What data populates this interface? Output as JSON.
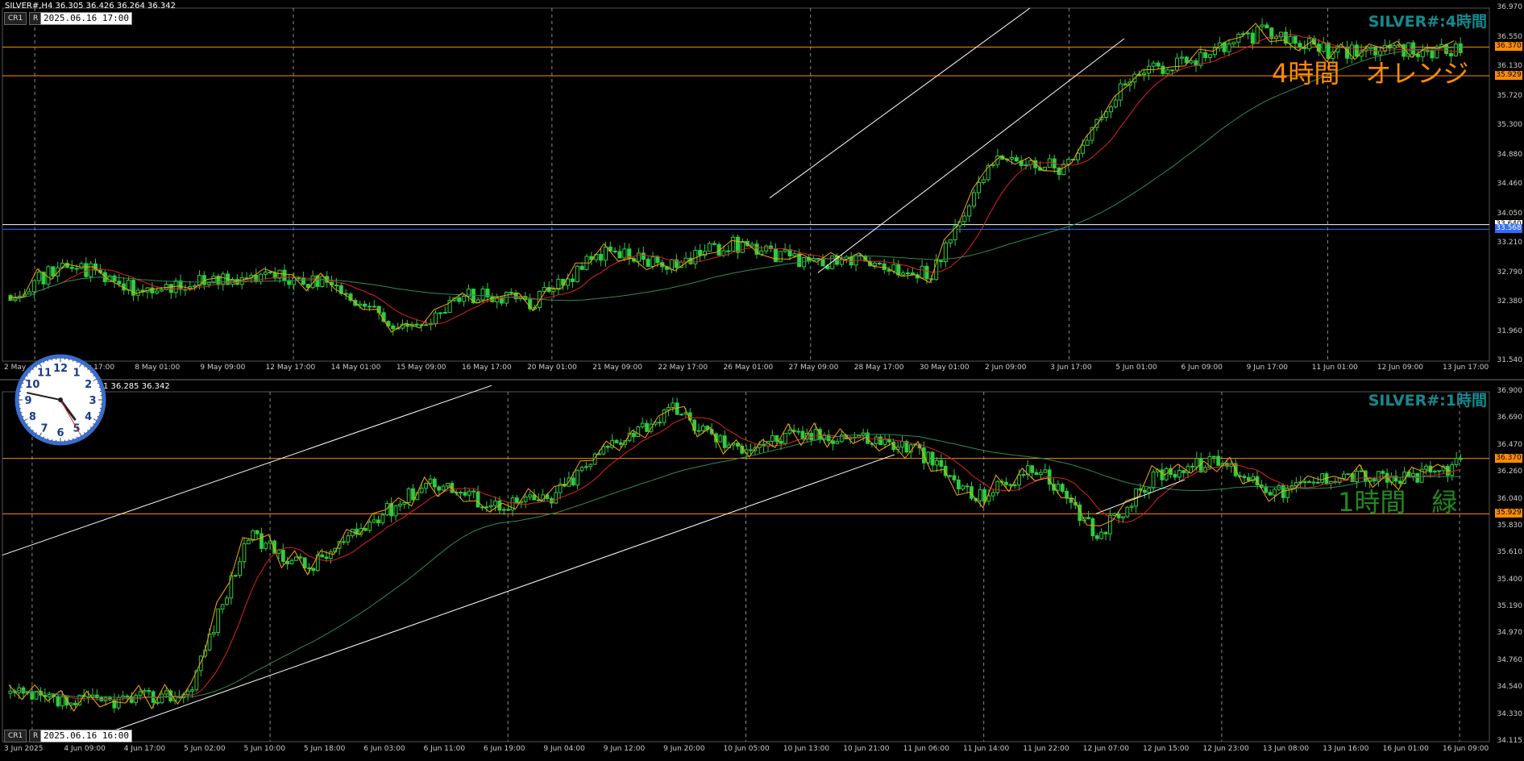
{
  "top_pane": {
    "symbol_info": "SILVER#,H4  36.305 36.426 36.264 36.342",
    "cr_label": "CR1",
    "r_label": "R",
    "datetime": "2025.06.16 17:00",
    "title": "SILVER#:4時間",
    "annotation": "4時間　オレンジ",
    "annotation_color": "#ff8c00",
    "y_ticks": [
      "36.970",
      "36.550",
      "36.130",
      "35.720",
      "35.300",
      "34.880",
      "34.460",
      "34.050",
      "33.210",
      "32.790",
      "32.380",
      "31.960",
      "31.540"
    ],
    "price_tags": [
      {
        "text": "36.370",
        "color": "#ff8c00"
      },
      {
        "text": "35.929",
        "color": "#ff8c00"
      },
      {
        "text": "33.640",
        "color": "#ffffff"
      },
      {
        "text": "33.568",
        "color": "#2f6cff"
      }
    ],
    "x_labels": [
      "2 May",
      "6 May 17:00",
      "8 May 01:00",
      "9 May 09:00",
      "12 May 17:00",
      "14 May 01:00",
      "15 May 09:00",
      "16 May 17:00",
      "20 May 01:00",
      "21 May 09:00",
      "22 May 17:00",
      "26 May 01:00",
      "27 May 09:00",
      "28 May 17:00",
      "30 May 01:00",
      "2 Jun 09:00",
      "3 Jun 17:00",
      "5 Jun 01:00",
      "6 Jun 09:00",
      "9 Jun 17:00",
      "11 Jun 01:00",
      "12 Jun 09:00",
      "13 Jun 17:00"
    ]
  },
  "bottom_pane": {
    "symbol_info": "1 36.285 36.342",
    "cr_label": "CR1",
    "r_label": "R",
    "datetime": "2025.06.16 16:00",
    "title": "SILVER#:1時間",
    "annotation": "1時間　緑",
    "annotation_color": "#1e8a1e",
    "y_ticks": [
      "36.900",
      "36.690",
      "36.470",
      "36.260",
      "36.040",
      "35.830",
      "35.610",
      "35.400",
      "35.190",
      "34.970",
      "34.760",
      "34.540",
      "34.330",
      "34.115"
    ],
    "price_tags": [
      {
        "text": "36.370",
        "color": "#ff8c00"
      },
      {
        "text": "35.929",
        "color": "#ff8c00"
      }
    ],
    "x_labels": [
      "3 Jun 2025",
      "4 Jun 09:00",
      "4 Jun 17:00",
      "5 Jun 02:00",
      "5 Jun 10:00",
      "5 Jun 18:00",
      "6 Jun 03:00",
      "6 Jun 11:00",
      "6 Jun 19:00",
      "9 Jun 04:00",
      "9 Jun 12:00",
      "9 Jun 20:00",
      "10 Jun 05:00",
      "10 Jun 13:00",
      "10 Jun 21:00",
      "11 Jun 06:00",
      "11 Jun 14:00",
      "11 Jun 22:00",
      "12 Jun 07:00",
      "12 Jun 15:00",
      "12 Jun 23:00",
      "13 Jun 08:00",
      "13 Jun 16:00",
      "16 Jun 01:00",
      "16 Jun 09:00"
    ]
  },
  "clock": {
    "numbers": [
      "12",
      "1",
      "2",
      "3",
      "4",
      "5",
      "6",
      "7",
      "8",
      "9",
      "10",
      "11"
    ],
    "hour": 16,
    "minute": 47,
    "second": 25
  },
  "chart_data": [
    {
      "type": "candlestick",
      "title": "SILVER#:4時間",
      "timeframe": "H4",
      "ylim": [
        31.54,
        36.97
      ],
      "x": [
        "2 May",
        "6 May 17:00",
        "8 May 01:00",
        "9 May 09:00",
        "12 May 17:00",
        "14 May 01:00",
        "15 May 09:00",
        "16 May 17:00",
        "20 May 01:00",
        "21 May 09:00",
        "22 May 17:00",
        "26 May 01:00",
        "27 May 09:00",
        "28 May 17:00",
        "30 May 01:00",
        "2 Jun 09:00",
        "3 Jun 17:00",
        "5 Jun 01:00",
        "6 Jun 09:00",
        "9 Jun 17:00",
        "11 Jun 01:00",
        "12 Jun 09:00",
        "13 Jun 17:00"
      ],
      "close": [
        32.55,
        33.05,
        32.6,
        32.75,
        32.85,
        32.7,
        32.0,
        32.55,
        32.45,
        33.2,
        33.05,
        33.35,
        33.1,
        33.05,
        32.9,
        34.75,
        34.5,
        35.95,
        36.2,
        36.6,
        36.3,
        36.35,
        36.3
      ],
      "horizontal_lines": [
        36.37,
        35.929,
        33.64,
        33.568
      ],
      "grid": true
    },
    {
      "type": "candlestick",
      "title": "SILVER#:1時間",
      "timeframe": "H1",
      "ylim": [
        34.115,
        36.9
      ],
      "x": [
        "3 Jun 2025",
        "4 Jun 09:00",
        "4 Jun 17:00",
        "5 Jun 02:00",
        "5 Jun 10:00",
        "5 Jun 18:00",
        "6 Jun 03:00",
        "6 Jun 11:00",
        "6 Jun 19:00",
        "9 Jun 04:00",
        "9 Jun 12:00",
        "9 Jun 20:00",
        "10 Jun 05:00",
        "10 Jun 13:00",
        "10 Jun 21:00",
        "11 Jun 06:00",
        "11 Jun 14:00",
        "11 Jun 22:00",
        "12 Jun 07:00",
        "12 Jun 15:00",
        "12 Jun 23:00",
        "13 Jun 08:00",
        "13 Jun 16:00",
        "16 Jun 01:00",
        "16 Jun 09:00"
      ],
      "close": [
        34.5,
        34.42,
        34.45,
        34.5,
        35.75,
        35.5,
        35.85,
        36.2,
        36.0,
        36.05,
        36.5,
        36.75,
        36.45,
        36.55,
        36.55,
        36.45,
        36.05,
        36.3,
        35.75,
        36.25,
        36.35,
        36.1,
        36.25,
        36.2,
        36.32
      ],
      "horizontal_lines": [
        36.37,
        35.929
      ],
      "grid": true
    }
  ]
}
